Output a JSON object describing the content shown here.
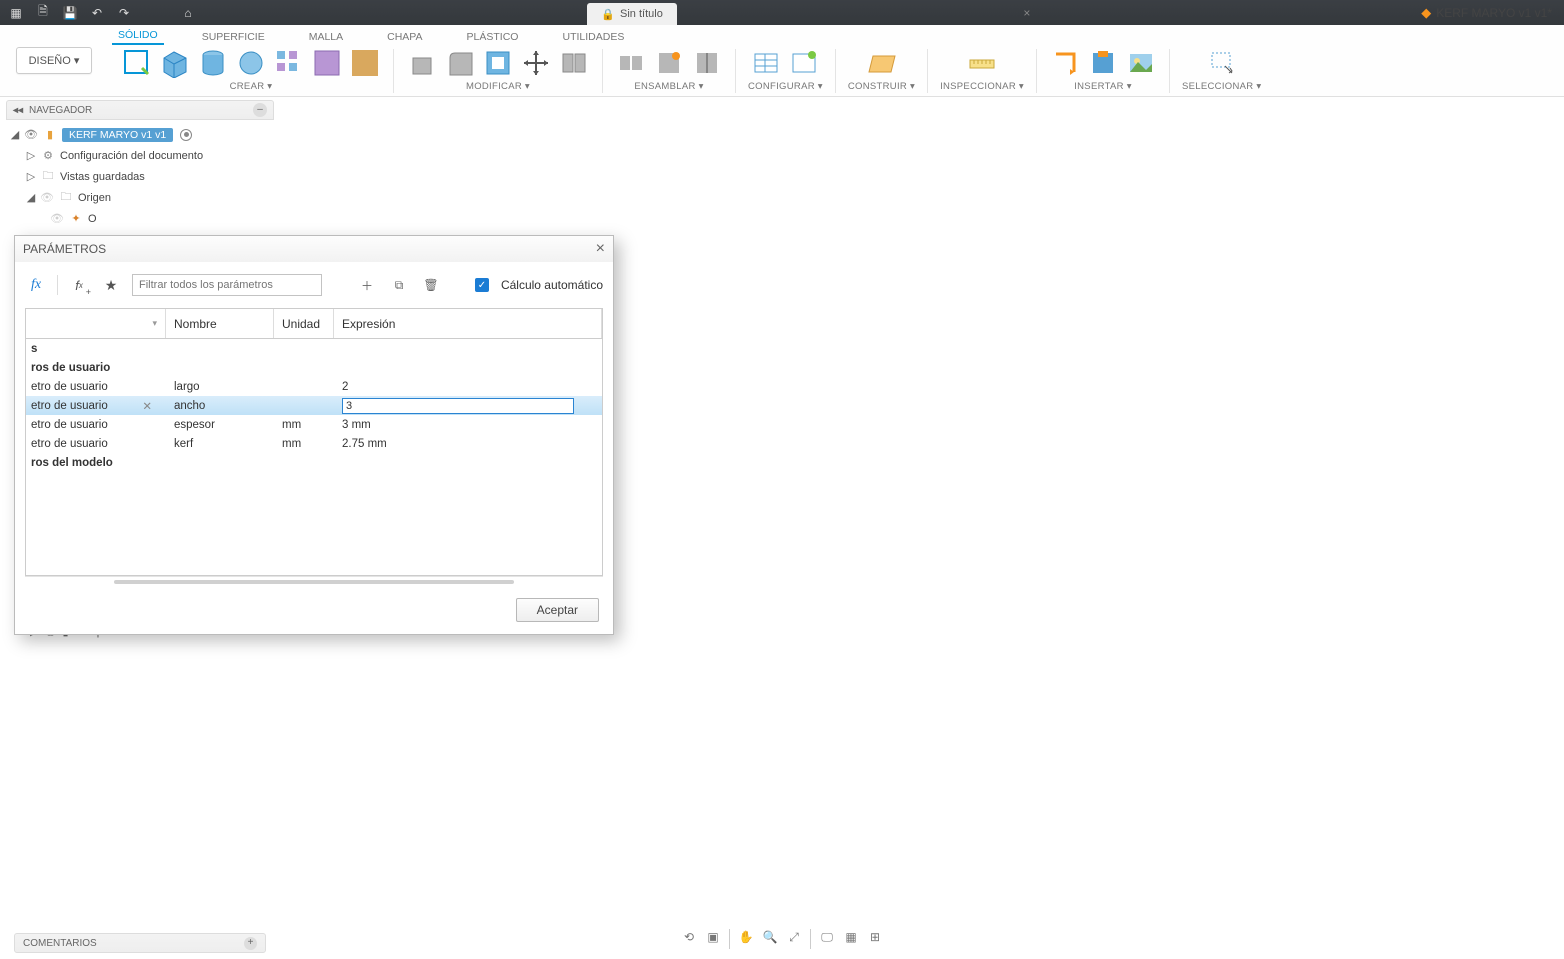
{
  "qat": {
    "doc_title": "Sin título",
    "doc2": "KERF MARYO v1 v1*"
  },
  "workspace": {
    "label": "DISEÑO ▾"
  },
  "ribbon_tabs": [
    "SÓLIDO",
    "SUPERFICIE",
    "MALLA",
    "CHAPA",
    "PLÁSTICO",
    "UTILIDADES"
  ],
  "ribbon_groups": {
    "crear": "CREAR ▾",
    "modificar": "MODIFICAR ▾",
    "ensamblar": "ENSAMBLAR ▾",
    "configurar": "CONFIGURAR ▾",
    "construir": "CONSTRUIR ▾",
    "inspeccionar": "INSPECCIONAR ▾",
    "insertar": "INSERTAR ▾",
    "seleccionar": "SELECCIONAR ▾"
  },
  "browser": {
    "title": "NAVEGADOR",
    "root": "KERF MARYO v1 v1",
    "items": {
      "config": "Configuración del documento",
      "views": "Vistas guardadas",
      "origin": "Origen",
      "originO": "O",
      "peek": "Componente2:1"
    }
  },
  "dialog": {
    "title": "PARÁMETROS",
    "filter_ph": "Filtrar todos los parámetros",
    "autocalc": "Cálculo automático",
    "headers": {
      "name": "Nombre",
      "unit": "Unidad",
      "expr": "Expresión"
    },
    "sections": {
      "user": "ros de usuario",
      "model": "ros del modelo",
      "s": "s"
    },
    "rowlabel": "etro de usuario",
    "rows": [
      {
        "name": "largo",
        "unit": "",
        "expr": "2"
      },
      {
        "name": "ancho",
        "unit": "",
        "expr": "3",
        "editing": true
      },
      {
        "name": "espesor",
        "unit": "mm",
        "expr": "3 mm"
      },
      {
        "name": "kerf",
        "unit": "mm",
        "expr": "2.75 mm"
      }
    ],
    "accept": "Aceptar"
  },
  "comments": {
    "label": "COMENTARIOS"
  }
}
